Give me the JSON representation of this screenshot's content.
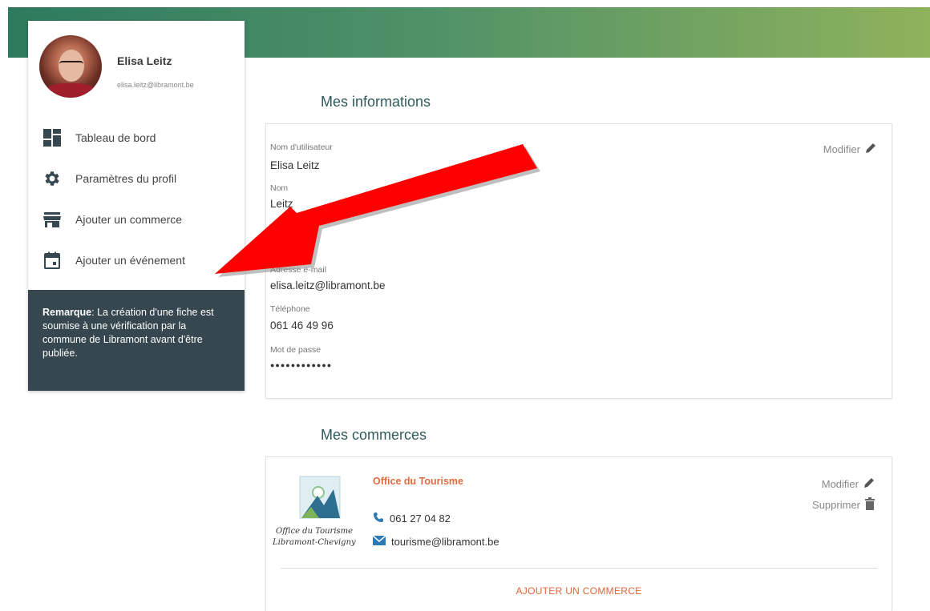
{
  "profile": {
    "name": "Elisa Leitz",
    "email": "elisa.leitz@libramont.be"
  },
  "sidebar": {
    "items": [
      {
        "label": "Tableau de bord",
        "icon": "dashboard-icon"
      },
      {
        "label": "Paramètres du profil",
        "icon": "gear-icon"
      },
      {
        "label": "Ajouter un commerce",
        "icon": "store-icon"
      },
      {
        "label": "Ajouter un événement",
        "icon": "calendar-icon"
      }
    ],
    "note_bold": "Remarque",
    "note_text": ": La création d'une fiche est soumise à une vérification par la commune de Libramont avant d'être publiée."
  },
  "info": {
    "title": "Mes informations",
    "modify_label": "Modifier",
    "fields": [
      {
        "label": "Nom d'utilisateur",
        "value": "Elisa Leitz"
      },
      {
        "label": "Nom",
        "value": "Leitz"
      },
      {
        "label": "Adresse e-mail",
        "value": "elisa.leitz@libramont.be"
      },
      {
        "label": "Téléphone",
        "value": "061 46 49 96"
      },
      {
        "label": "Mot de passe",
        "value": "●●●●●●●●●●●●"
      }
    ]
  },
  "shops": {
    "title": "Mes commerces",
    "items": [
      {
        "name": "Office du Tourisme",
        "phone": "061 27 04 82",
        "email": "tourisme@libramont.be",
        "logo_line1": "Office du Tourisme",
        "logo_line2": "Libramont-Chevigny"
      }
    ],
    "modify_label": "Modifier",
    "delete_label": "Supprimer",
    "add_label": "AJOUTER UN COMMERCE"
  },
  "colors": {
    "accent_orange": "#e0653a",
    "note_bg": "#37474f",
    "annotation_arrow": "#ff0000"
  }
}
